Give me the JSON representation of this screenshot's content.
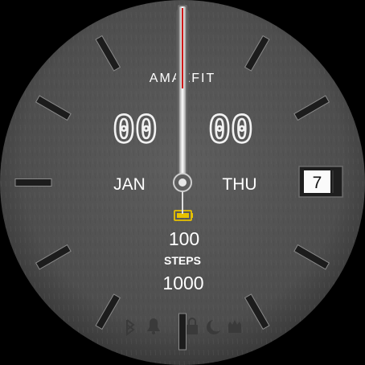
{
  "brand": "AMAZFIT",
  "time": {
    "hours": "00",
    "minutes": "00"
  },
  "date": {
    "month": "JAN",
    "weekday": "THU",
    "day": "7"
  },
  "battery": {
    "value": "100",
    "icon": "battery-icon",
    "color": "#e8c200"
  },
  "steps": {
    "label": "STEPS",
    "value": "1000"
  },
  "status_icons": [
    "bluetooth-icon",
    "alarm-bell-icon",
    "lock-icon",
    "moon-icon",
    "notification-icon"
  ],
  "colors": {
    "dial": "#555555",
    "marker": "#1c1c1c",
    "hand": "#e6e6e6",
    "second_hand": "#d01818",
    "text": "#ffffff"
  }
}
